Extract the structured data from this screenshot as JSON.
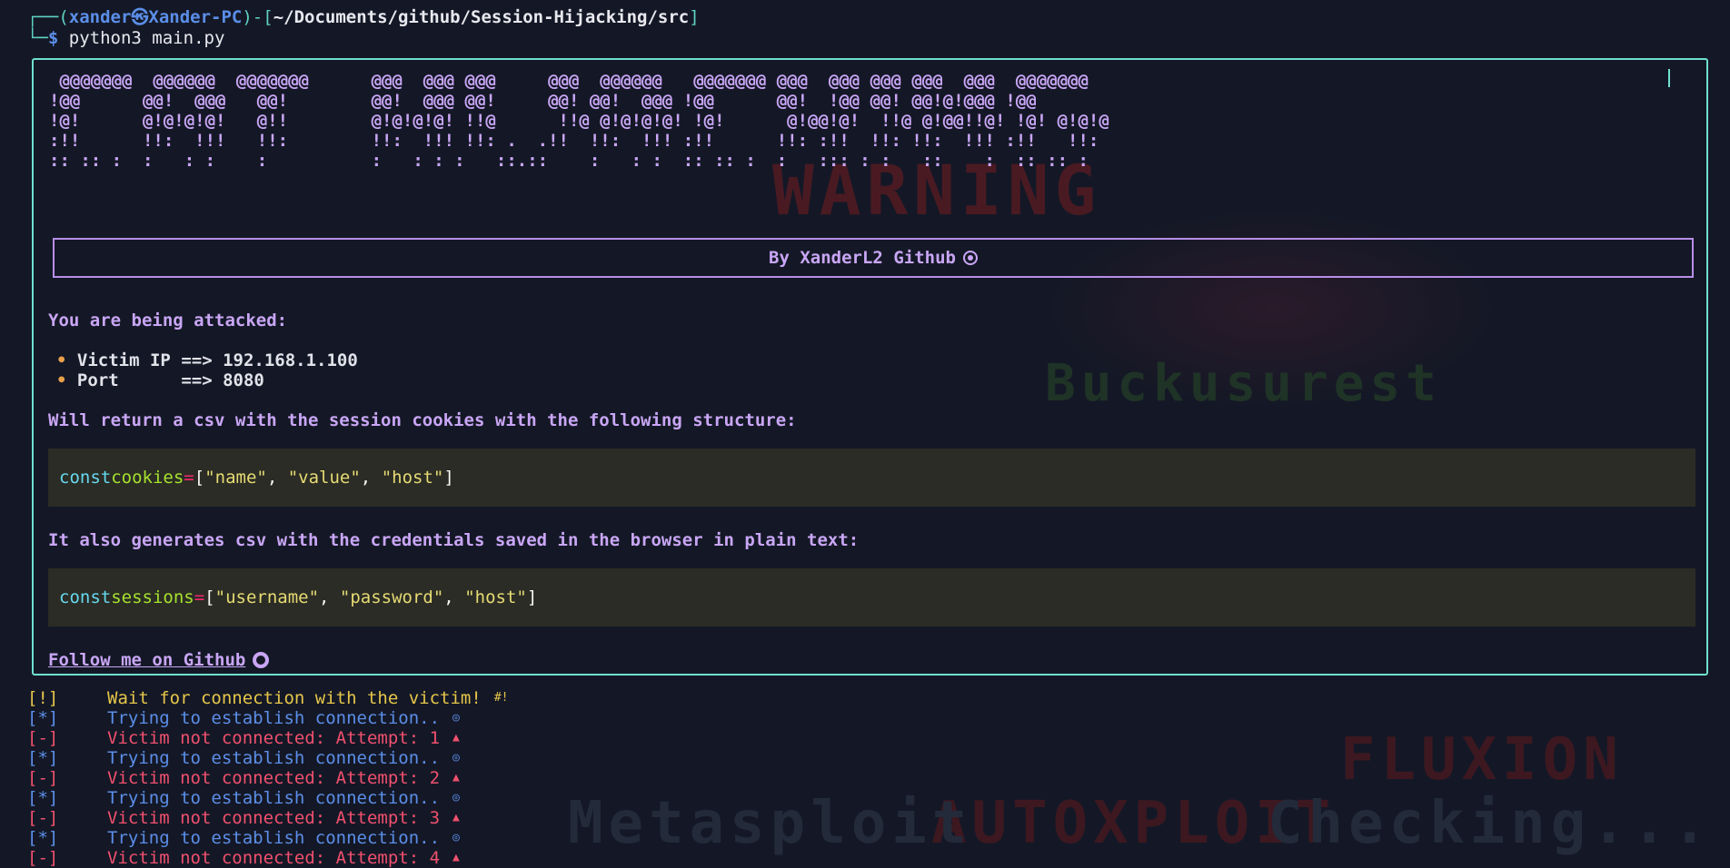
{
  "prompt": {
    "corner_top": "┌──(",
    "user": "xander㉿Xander-PC",
    "sep": ")-[",
    "path": "~/Documents/github/Session-Hijacking/src",
    "close": "]",
    "corner_bottom": "└─",
    "dollar": "$",
    "command": "python3 main.py"
  },
  "banner": {
    "ascii": " @@@@@@@  @@@@@@  @@@@@@@      @@@  @@@ @@@     @@@  @@@@@@   @@@@@@@ @@@  @@@ @@@ @@@  @@@  @@@@@@@\n!@@      @@!  @@@   @@!        @@!  @@@ @@!     @@! @@!  @@@ !@@      @@!  !@@ @@! @@!@!@@@ !@@\n!@!      @!@!@!@!   @!!        @!@!@!@! !!@      !!@ @!@!@!@! !@!      @!@@!@!  !!@ @!@@!!@! !@! @!@!@\n:!!      !!:  !!!   !!:        !!:  !!! !!: .  .!!  !!:  !!! :!!      !!: :!!  !!: !!:  !!! :!!   !!:\n:: :: :  :   : :    :          :   : : :   ::.::    :   : :  :: :: :  :   ::: : :   ::    :  :: :: :",
    "byline": "By XanderL2 Github"
  },
  "content": {
    "attacked_heading": "You are being attacked:",
    "bullets": [
      {
        "bullet": "•",
        "label": "Victim IP",
        "arrow": "==>",
        "value": "192.168.1.100"
      },
      {
        "bullet": "•",
        "label": "Port     ",
        "arrow": "==>",
        "value": "8080"
      }
    ],
    "csv_heading": "Will return a csv with the session cookies with the following structure:",
    "code1": {
      "kw": "const",
      "var": "cookies",
      "op": "=",
      "open": "[",
      "s1": "\"name\"",
      "s2": "\"value\"",
      "s3": "\"host\"",
      "close": "]"
    },
    "cred_heading": "It also generates csv with the credentials saved in the browser in plain text:",
    "code2": {
      "kw": "const",
      "var": "sessions",
      "op": "=",
      "open": "[",
      "s1": "\"username\"",
      "s2": "\"password\"",
      "s3": "\"host\"",
      "close": "]"
    },
    "follow": "Follow me on Github"
  },
  "log": [
    {
      "tag": "[!]",
      "msg": "Wait for connection with the victim!",
      "kind": "wait",
      "icon": "#!"
    },
    {
      "tag": "[*]",
      "msg": "Trying to establish connection..",
      "kind": "try",
      "icon": "◎"
    },
    {
      "tag": "[-]",
      "msg": "Victim not connected: Attempt: 1",
      "kind": "fail",
      "icon": "▲"
    },
    {
      "tag": "[*]",
      "msg": "Trying to establish connection..",
      "kind": "try",
      "icon": "◎"
    },
    {
      "tag": "[-]",
      "msg": "Victim not connected: Attempt: 2",
      "kind": "fail",
      "icon": "▲"
    },
    {
      "tag": "[*]",
      "msg": "Trying to establish connection..",
      "kind": "try",
      "icon": "◎"
    },
    {
      "tag": "[-]",
      "msg": "Victim not connected: Attempt: 3",
      "kind": "fail",
      "icon": "▲"
    },
    {
      "tag": "[*]",
      "msg": "Trying to establish connection..",
      "kind": "try",
      "icon": "◎"
    },
    {
      "tag": "[-]",
      "msg": "Victim not connected: Attempt: 4",
      "kind": "fail",
      "icon": "▲"
    }
  ],
  "background_art": {
    "warning": "WARNING",
    "fluxion": "FLUXION",
    "autoxploit": "AUTOXPLOIT",
    "checking": "Checking...",
    "metasploit": "Metasploit",
    "buck": "Buckusurest"
  },
  "colors": {
    "background": "#141826",
    "panel_border": "#6fe0cf",
    "accent": "#c9a6f5",
    "code_bg": "#2b2c25"
  }
}
